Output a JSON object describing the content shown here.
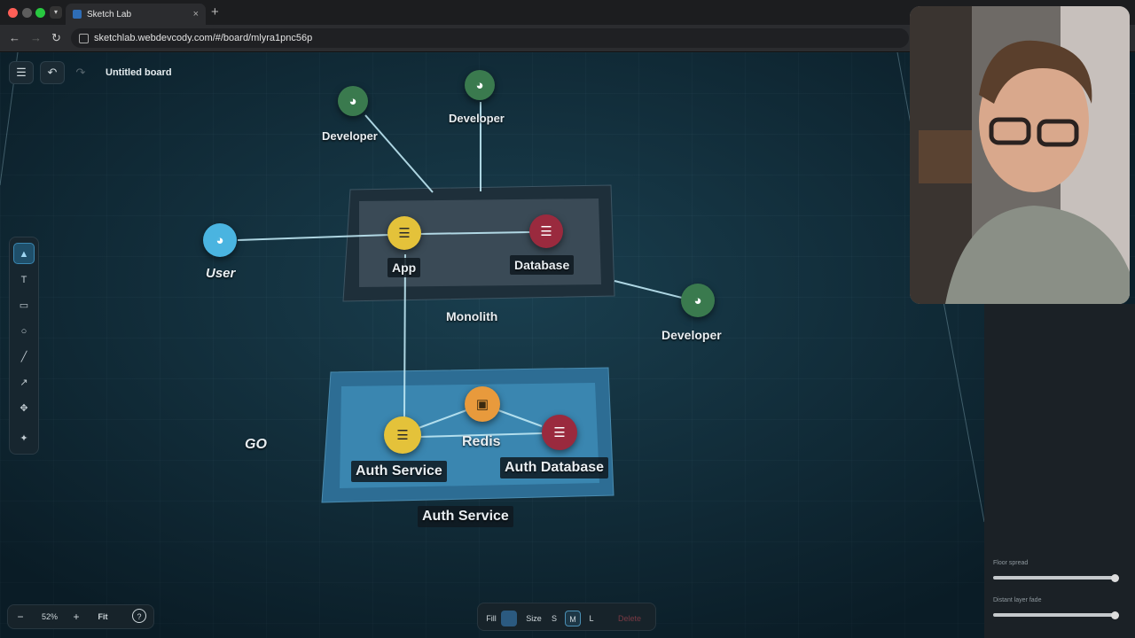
{
  "browser": {
    "tab_title": "Sketch Lab",
    "tab_close": "×",
    "new_tab": "+",
    "url": "sketchlab.webdevcody.com/#/board/mlyra1pnc56p"
  },
  "board": {
    "title": "Untitled board"
  },
  "toolbar": {
    "tools": [
      {
        "name": "select",
        "icon": "▲",
        "key": "V"
      },
      {
        "name": "text",
        "icon": "T",
        "key": "T"
      },
      {
        "name": "rectangle",
        "icon": "▭",
        "key": "R"
      },
      {
        "name": "ellipse",
        "icon": "○",
        "key": "O"
      },
      {
        "name": "line",
        "icon": "╱",
        "key": "L"
      },
      {
        "name": "arrow",
        "icon": "↗",
        "key": "A"
      },
      {
        "name": "move",
        "icon": "✥",
        "key": "M"
      },
      {
        "name": "icon",
        "icon": "✦",
        "key": "I"
      }
    ]
  },
  "diagram": {
    "developer_label": "Developer",
    "user_label": "User",
    "app_label": "App",
    "database_label": "Database",
    "monolith_label": "Monolith",
    "auth_service_label": "Auth Service",
    "redis_label": "Redis",
    "auth_database_label": "Auth Database",
    "group_auth_label": "Auth Service",
    "floating_text": "GO",
    "colors": {
      "developer": "#3a7a4e",
      "user": "#4ab4e0",
      "service": "#e4c23a",
      "database": "#9a2a3e",
      "cache": "#e89a3c"
    }
  },
  "zoom": {
    "minus": "−",
    "value": "52%",
    "plus": "+",
    "fit": "Fit",
    "help": "?"
  },
  "style_bar": {
    "fill_label": "Fill",
    "fill_color": "#2b5a80",
    "size_label": "Size",
    "sizes": [
      "S",
      "M",
      "L"
    ],
    "selected_size": "M",
    "delete_label": "Delete"
  },
  "side_panel": {
    "floor_spread_label": "Floor spread",
    "floor_spread_value": 1.0,
    "distant_layer_fade_label": "Distant layer fade",
    "distant_layer_fade_value": 1.0
  }
}
